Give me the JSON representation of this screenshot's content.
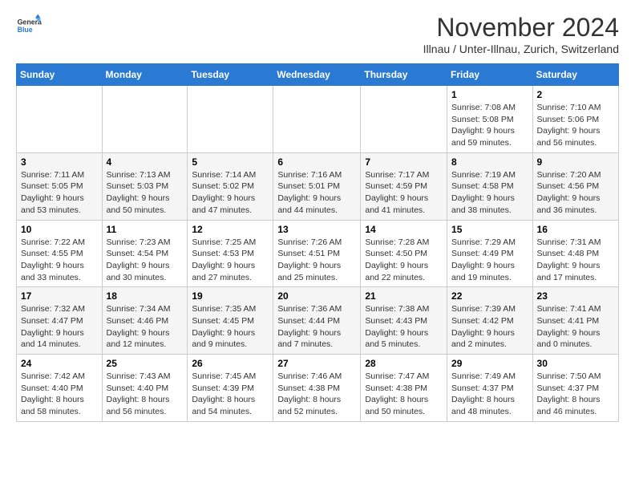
{
  "logo": {
    "line1": "General",
    "line2": "Blue"
  },
  "header": {
    "month": "November 2024",
    "location": "Illnau / Unter-Illnau, Zurich, Switzerland"
  },
  "weekdays": [
    "Sunday",
    "Monday",
    "Tuesday",
    "Wednesday",
    "Thursday",
    "Friday",
    "Saturday"
  ],
  "weeks": [
    [
      {
        "day": "",
        "info": ""
      },
      {
        "day": "",
        "info": ""
      },
      {
        "day": "",
        "info": ""
      },
      {
        "day": "",
        "info": ""
      },
      {
        "day": "",
        "info": ""
      },
      {
        "day": "1",
        "info": "Sunrise: 7:08 AM\nSunset: 5:08 PM\nDaylight: 9 hours and 59 minutes."
      },
      {
        "day": "2",
        "info": "Sunrise: 7:10 AM\nSunset: 5:06 PM\nDaylight: 9 hours and 56 minutes."
      }
    ],
    [
      {
        "day": "3",
        "info": "Sunrise: 7:11 AM\nSunset: 5:05 PM\nDaylight: 9 hours and 53 minutes."
      },
      {
        "day": "4",
        "info": "Sunrise: 7:13 AM\nSunset: 5:03 PM\nDaylight: 9 hours and 50 minutes."
      },
      {
        "day": "5",
        "info": "Sunrise: 7:14 AM\nSunset: 5:02 PM\nDaylight: 9 hours and 47 minutes."
      },
      {
        "day": "6",
        "info": "Sunrise: 7:16 AM\nSunset: 5:01 PM\nDaylight: 9 hours and 44 minutes."
      },
      {
        "day": "7",
        "info": "Sunrise: 7:17 AM\nSunset: 4:59 PM\nDaylight: 9 hours and 41 minutes."
      },
      {
        "day": "8",
        "info": "Sunrise: 7:19 AM\nSunset: 4:58 PM\nDaylight: 9 hours and 38 minutes."
      },
      {
        "day": "9",
        "info": "Sunrise: 7:20 AM\nSunset: 4:56 PM\nDaylight: 9 hours and 36 minutes."
      }
    ],
    [
      {
        "day": "10",
        "info": "Sunrise: 7:22 AM\nSunset: 4:55 PM\nDaylight: 9 hours and 33 minutes."
      },
      {
        "day": "11",
        "info": "Sunrise: 7:23 AM\nSunset: 4:54 PM\nDaylight: 9 hours and 30 minutes."
      },
      {
        "day": "12",
        "info": "Sunrise: 7:25 AM\nSunset: 4:53 PM\nDaylight: 9 hours and 27 minutes."
      },
      {
        "day": "13",
        "info": "Sunrise: 7:26 AM\nSunset: 4:51 PM\nDaylight: 9 hours and 25 minutes."
      },
      {
        "day": "14",
        "info": "Sunrise: 7:28 AM\nSunset: 4:50 PM\nDaylight: 9 hours and 22 minutes."
      },
      {
        "day": "15",
        "info": "Sunrise: 7:29 AM\nSunset: 4:49 PM\nDaylight: 9 hours and 19 minutes."
      },
      {
        "day": "16",
        "info": "Sunrise: 7:31 AM\nSunset: 4:48 PM\nDaylight: 9 hours and 17 minutes."
      }
    ],
    [
      {
        "day": "17",
        "info": "Sunrise: 7:32 AM\nSunset: 4:47 PM\nDaylight: 9 hours and 14 minutes."
      },
      {
        "day": "18",
        "info": "Sunrise: 7:34 AM\nSunset: 4:46 PM\nDaylight: 9 hours and 12 minutes."
      },
      {
        "day": "19",
        "info": "Sunrise: 7:35 AM\nSunset: 4:45 PM\nDaylight: 9 hours and 9 minutes."
      },
      {
        "day": "20",
        "info": "Sunrise: 7:36 AM\nSunset: 4:44 PM\nDaylight: 9 hours and 7 minutes."
      },
      {
        "day": "21",
        "info": "Sunrise: 7:38 AM\nSunset: 4:43 PM\nDaylight: 9 hours and 5 minutes."
      },
      {
        "day": "22",
        "info": "Sunrise: 7:39 AM\nSunset: 4:42 PM\nDaylight: 9 hours and 2 minutes."
      },
      {
        "day": "23",
        "info": "Sunrise: 7:41 AM\nSunset: 4:41 PM\nDaylight: 9 hours and 0 minutes."
      }
    ],
    [
      {
        "day": "24",
        "info": "Sunrise: 7:42 AM\nSunset: 4:40 PM\nDaylight: 8 hours and 58 minutes."
      },
      {
        "day": "25",
        "info": "Sunrise: 7:43 AM\nSunset: 4:40 PM\nDaylight: 8 hours and 56 minutes."
      },
      {
        "day": "26",
        "info": "Sunrise: 7:45 AM\nSunset: 4:39 PM\nDaylight: 8 hours and 54 minutes."
      },
      {
        "day": "27",
        "info": "Sunrise: 7:46 AM\nSunset: 4:38 PM\nDaylight: 8 hours and 52 minutes."
      },
      {
        "day": "28",
        "info": "Sunrise: 7:47 AM\nSunset: 4:38 PM\nDaylight: 8 hours and 50 minutes."
      },
      {
        "day": "29",
        "info": "Sunrise: 7:49 AM\nSunset: 4:37 PM\nDaylight: 8 hours and 48 minutes."
      },
      {
        "day": "30",
        "info": "Sunrise: 7:50 AM\nSunset: 4:37 PM\nDaylight: 8 hours and 46 minutes."
      }
    ]
  ]
}
